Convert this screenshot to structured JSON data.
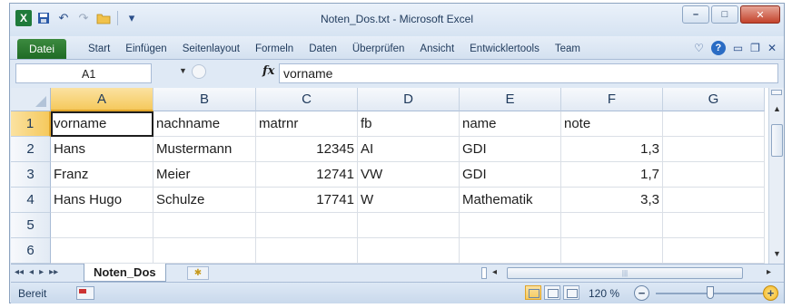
{
  "app": {
    "title": "Noten_Dos.txt  -  Microsoft Excel",
    "icon_letter": "X"
  },
  "window_controls": {
    "minimize": "–",
    "maximize": "□",
    "close": "✕"
  },
  "qat": {
    "save_icon": "save-icon",
    "undo_icon": "undo-icon",
    "redo_icon": "redo-icon",
    "open_icon": "open-folder-icon",
    "customize": "▾"
  },
  "ribbon": {
    "file_tab": "Datei",
    "tabs": [
      "Start",
      "Einfügen",
      "Seitenlayout",
      "Formeln",
      "Daten",
      "Überprüfen",
      "Ansicht",
      "Entwicklertools",
      "Team"
    ],
    "right_icons": [
      "heart-icon",
      "help-icon",
      "minimize-ribbon-icon",
      "restore-icon",
      "close-workbook-icon"
    ]
  },
  "formula_bar": {
    "name_box": "A1",
    "fx": "fx",
    "value": "vorname"
  },
  "columns": [
    "A",
    "B",
    "C",
    "D",
    "E",
    "F",
    "G"
  ],
  "rows": [
    "1",
    "2",
    "3",
    "4",
    "5",
    "6"
  ],
  "cells": [
    [
      "vorname",
      "nachname",
      "matrnr",
      "fb",
      "name",
      "note",
      ""
    ],
    [
      "Hans",
      "Mustermann",
      "12345",
      "AI",
      "GDI",
      "1,3",
      ""
    ],
    [
      "Franz",
      "Meier",
      "12741",
      "VW",
      "GDI",
      "1,7",
      ""
    ],
    [
      "Hans Hugo",
      "Schulze",
      "17741",
      "W",
      "Mathematik",
      "3,3",
      ""
    ],
    [
      "",
      "",
      "",
      "",
      "",
      "",
      ""
    ],
    [
      "",
      "",
      "",
      "",
      "",
      "",
      ""
    ]
  ],
  "active_cell": "A1",
  "sheets": {
    "active": "Noten_Dos",
    "nav": [
      "◂◂",
      "◂",
      "▸",
      "▸▸"
    ]
  },
  "status": {
    "ready": "Bereit",
    "zoom": "120 %",
    "zoom_minus": "−",
    "zoom_plus": "+"
  }
}
